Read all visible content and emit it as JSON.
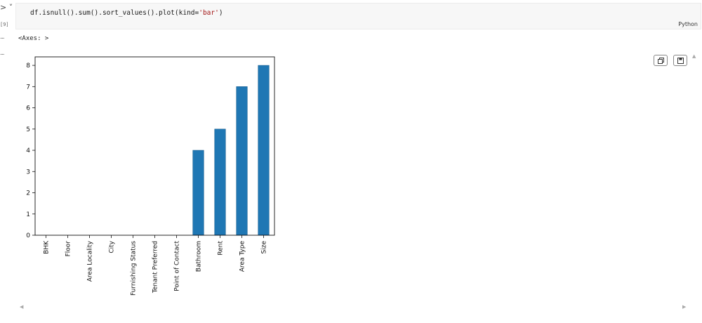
{
  "cell": {
    "run_toggle": "> ˅",
    "execution_count": "[9]",
    "gutter_dots": "...",
    "code_prefix": "df.isnull().sum().sort_values().plot(kind=",
    "code_string": "'bar'",
    "code_suffix": ")",
    "language": "Python"
  },
  "output": {
    "text": "<Axes: >",
    "copy_icon": "copy-icon",
    "save_icon": "save-icon"
  },
  "chart_data": {
    "type": "bar",
    "categories": [
      "BHK",
      "Floor",
      "Area Locality",
      "City",
      "Furnishing Status",
      "Tenant Preferred",
      "Point of Contact",
      "Bathroom",
      "Rent",
      "Area Type",
      "Size"
    ],
    "values": [
      0,
      0,
      0,
      0,
      0,
      0,
      0,
      4,
      5,
      7,
      8
    ],
    "ylim": [
      0,
      8.4
    ],
    "yticks": [
      0,
      1,
      2,
      3,
      4,
      5,
      6,
      7,
      8
    ],
    "bar_color": "#1f77b4",
    "grid": false
  }
}
